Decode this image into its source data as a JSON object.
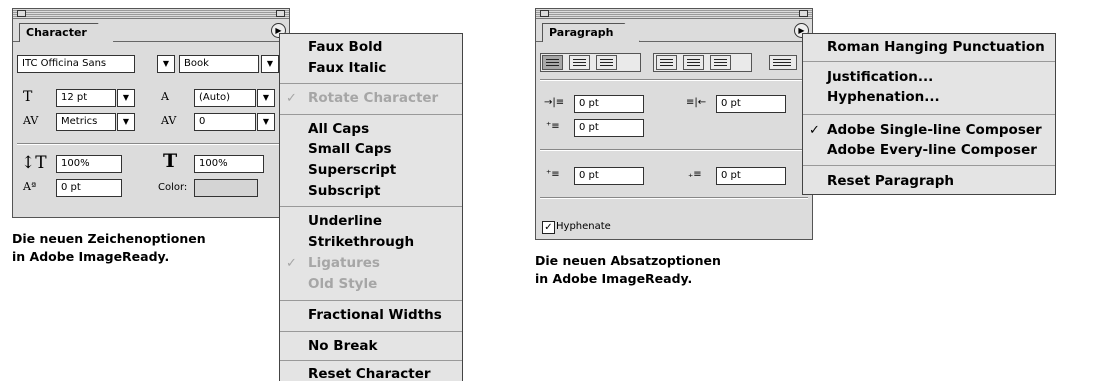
{
  "character_panel": {
    "tab_label": "Character",
    "font_family": "ITC Officina Sans",
    "font_style": "Book",
    "size": "12 pt",
    "leading": "(Auto)",
    "kerning": "Metrics",
    "tracking": "0",
    "vertical_scale": "100%",
    "horizontal_scale": "100%",
    "baseline_shift": "0 pt",
    "color_label": "Color:",
    "color_swatch": "#d4d4d4"
  },
  "character_menu": {
    "items": [
      {
        "label": "Faux Bold",
        "enabled": true,
        "checked": false
      },
      {
        "label": "Faux Italic",
        "enabled": true,
        "checked": false
      },
      {
        "label": "Rotate Character",
        "enabled": false,
        "checked": true
      },
      {
        "label": "All Caps",
        "enabled": true,
        "checked": false
      },
      {
        "label": "Small Caps",
        "enabled": true,
        "checked": false
      },
      {
        "label": "Superscript",
        "enabled": true,
        "checked": false
      },
      {
        "label": "Subscript",
        "enabled": true,
        "checked": false
      },
      {
        "label": "Underline",
        "enabled": true,
        "checked": false
      },
      {
        "label": "Strikethrough",
        "enabled": true,
        "checked": false
      },
      {
        "label": "Ligatures",
        "enabled": false,
        "checked": true
      },
      {
        "label": "Old Style",
        "enabled": false,
        "checked": false
      },
      {
        "label": "Fractional Widths",
        "enabled": true,
        "checked": false
      },
      {
        "label": "No Break",
        "enabled": true,
        "checked": false
      },
      {
        "label": "Reset Character",
        "enabled": true,
        "checked": false
      }
    ]
  },
  "character_caption": {
    "line1": "Die neuen Zeichenoptionen",
    "line2": "in Adobe ImageReady."
  },
  "paragraph_panel": {
    "tab_label": "Paragraph",
    "left_indent": "0 pt",
    "right_indent": "0 pt",
    "first_line_indent": "0 pt",
    "space_before": "0 pt",
    "space_after": "0 pt",
    "hyphenate_label": "Hyphenate",
    "hyphenate_checked": true
  },
  "paragraph_menu": {
    "items": [
      {
        "label": "Roman Hanging Punctuation",
        "checked": false
      },
      {
        "label": "Justification...",
        "checked": false
      },
      {
        "label": "Hyphenation...",
        "checked": false
      },
      {
        "label": "Adobe Single-line Composer",
        "checked": true
      },
      {
        "label": "Adobe Every-line Composer",
        "checked": false
      },
      {
        "label": "Reset Paragraph",
        "checked": false
      }
    ]
  },
  "paragraph_caption": {
    "line1": "Die neuen Absatzoptionen",
    "line2": "in Adobe ImageReady."
  },
  "glyphs": {
    "check": "✓",
    "dropdown_arrow": "▼",
    "flyout_arrow": "▶"
  }
}
